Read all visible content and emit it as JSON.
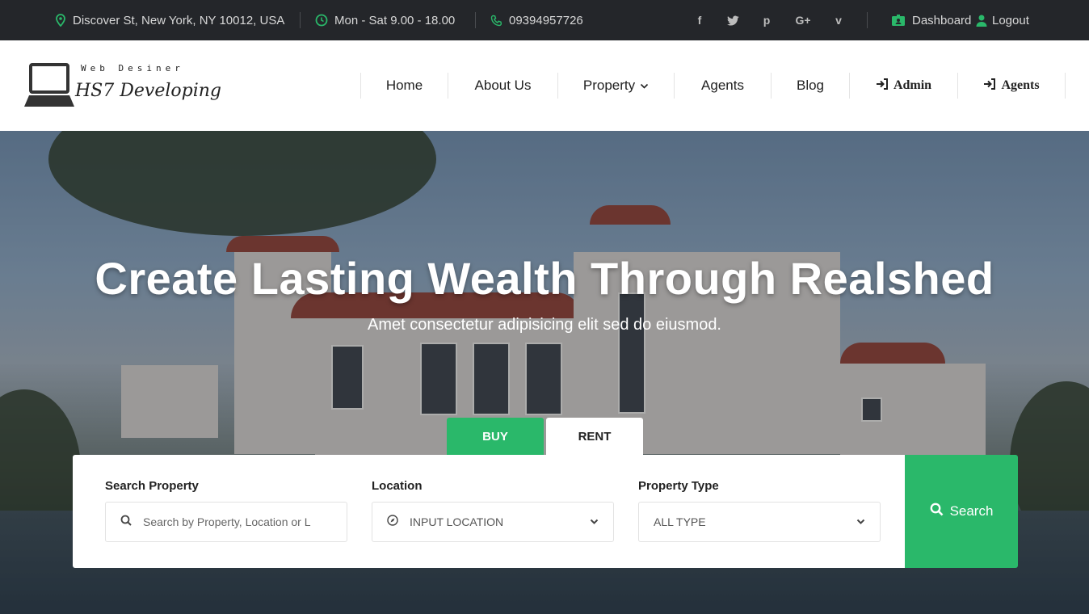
{
  "topbar": {
    "address": "Discover St, New York, NY 10012, USA",
    "hours": "Mon - Sat 9.00 - 18.00",
    "phone": "09394957726",
    "social": [
      "f",
      "t",
      "p",
      "G+",
      "v"
    ],
    "dashboard_label": "Dashboard",
    "logout_label": "Logout",
    "accent_color": "#2ab86a"
  },
  "header": {
    "logo_sub": "Web Desiner",
    "logo_main": "HS7 Developing",
    "nav": {
      "home": "Home",
      "about": "About Us",
      "property": "Property",
      "agents": "Agents",
      "blog": "Blog",
      "admin": "Admin",
      "agents_login": "Agents"
    }
  },
  "hero": {
    "title": "Create Lasting Wealth Through Realshed",
    "subtitle": "Amet consectetur adipisicing elit sed do eiusmod."
  },
  "search": {
    "tabs": {
      "buy": "BUY",
      "rent": "RENT"
    },
    "active_tab": "BUY",
    "property_label": "Search Property",
    "property_placeholder": "Search by Property, Location or L",
    "location_label": "Location",
    "location_value": "INPUT LOCATION",
    "type_label": "Property Type",
    "type_value": "ALL TYPE",
    "button_label": "Search",
    "button_color": "#2ab86a"
  }
}
